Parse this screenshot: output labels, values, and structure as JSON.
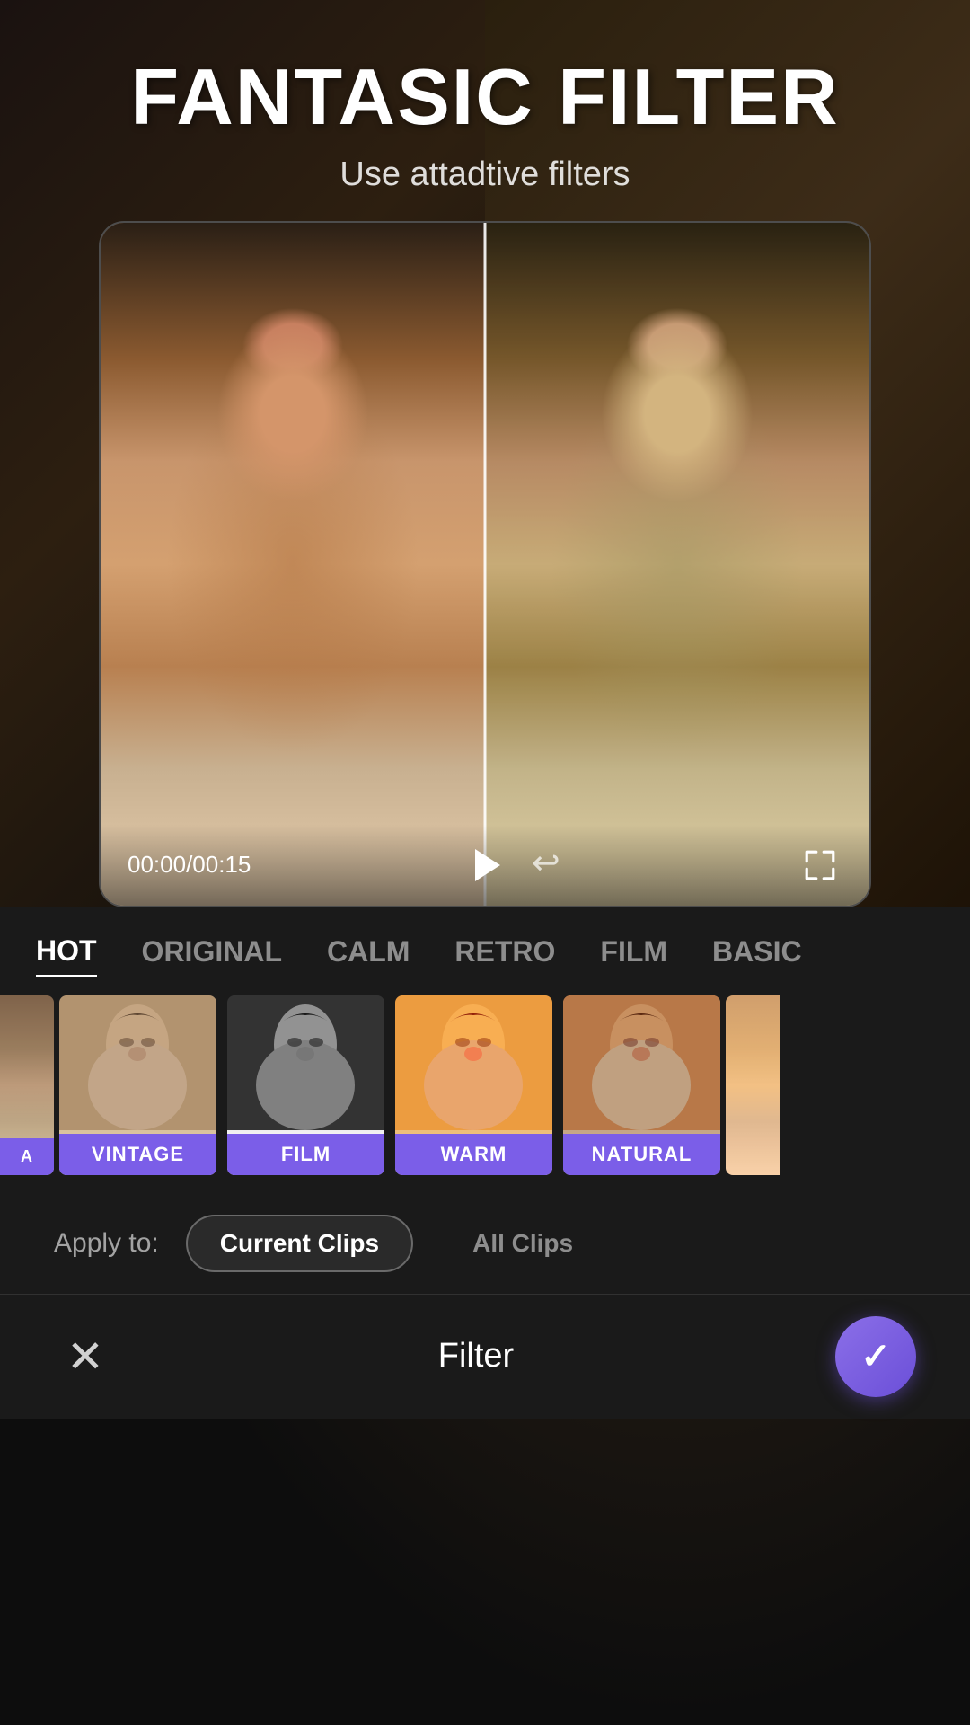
{
  "header": {
    "title": "FANTASIC FILTER",
    "subtitle": "Use attadtive filters"
  },
  "video": {
    "time_current": "00:00",
    "time_total": "00:15",
    "time_display": "00:00/00:15"
  },
  "filter_tabs": [
    {
      "id": "hot",
      "label": "HOT",
      "active": true
    },
    {
      "id": "original",
      "label": "ORIGINAL",
      "active": false
    },
    {
      "id": "calm",
      "label": "CALM",
      "active": false
    },
    {
      "id": "retro",
      "label": "RETRO",
      "active": false
    },
    {
      "id": "film",
      "label": "FILM",
      "active": false
    },
    {
      "id": "basic",
      "label": "BASIC",
      "active": false
    }
  ],
  "filter_items": [
    {
      "id": "partial-left",
      "label": "...",
      "style": "partial-left"
    },
    {
      "id": "vintage",
      "label": "VINTAGE",
      "style": "vintage"
    },
    {
      "id": "film",
      "label": "FILM",
      "style": "film"
    },
    {
      "id": "warm",
      "label": "WARM",
      "style": "warm"
    },
    {
      "id": "natural",
      "label": "NATURAL",
      "style": "natural"
    },
    {
      "id": "partial-right",
      "label": "...",
      "style": "partial-right"
    }
  ],
  "apply": {
    "label": "Apply to:",
    "current_clips": "Current Clips",
    "all_clips": "All Clips"
  },
  "bottom_bar": {
    "title": "Filter",
    "close_label": "×",
    "confirm_label": "✓"
  }
}
